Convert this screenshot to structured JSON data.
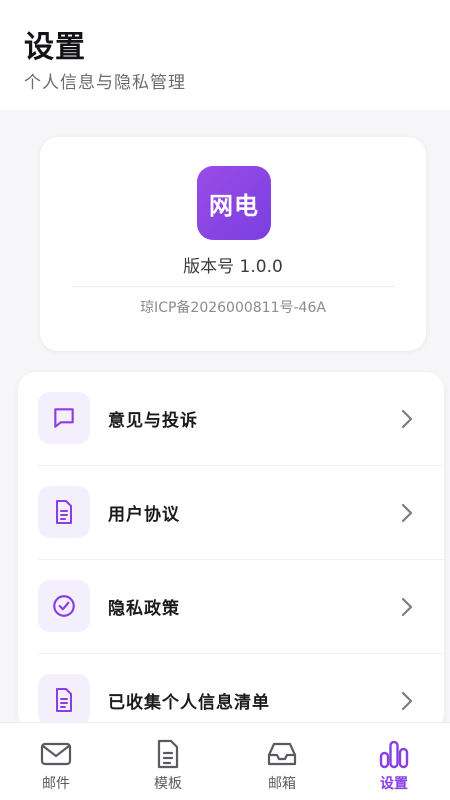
{
  "header": {
    "title": "设置",
    "subtitle": "个人信息与隐私管理"
  },
  "about": {
    "logo_text": "网电",
    "version": "版本号 1.0.0",
    "icp": "琼ICP备2026000811号-46A"
  },
  "menu": [
    {
      "label": "意见与投诉",
      "icon": "message-square-icon"
    },
    {
      "label": "用户协议",
      "icon": "document-icon"
    },
    {
      "label": "隐私政策",
      "icon": "check-circle-icon"
    },
    {
      "label": "已收集个人信息清单",
      "icon": "document-icon"
    }
  ],
  "tabs": [
    {
      "label": "邮件",
      "icon": "mail-icon",
      "active": false
    },
    {
      "label": "模板",
      "icon": "document-icon",
      "active": false
    },
    {
      "label": "邮箱",
      "icon": "inbox-icon",
      "active": false
    },
    {
      "label": "设置",
      "icon": "bar-chart-icon",
      "active": true
    }
  ],
  "colors": {
    "accent": "#8a3fe3",
    "icon_bg": "#f4effc"
  }
}
